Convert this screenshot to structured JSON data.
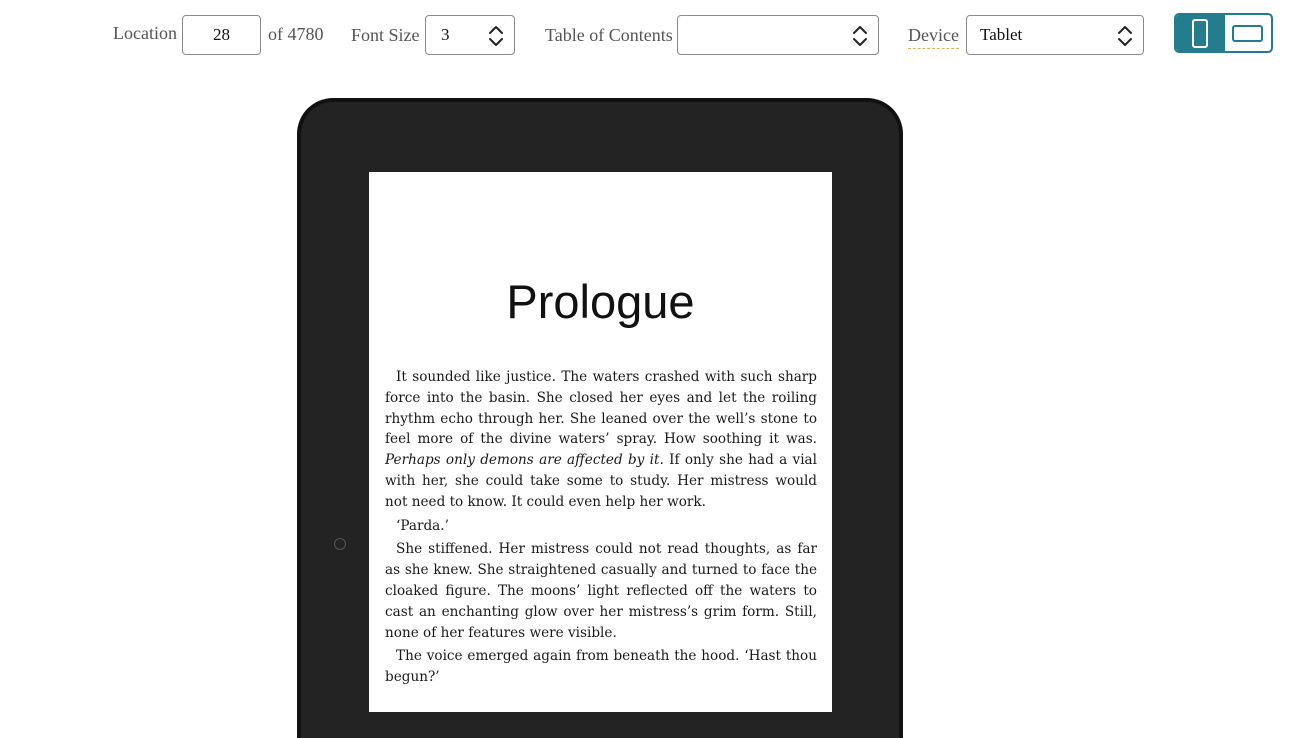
{
  "toolbar": {
    "location_label": "Location",
    "location_value": "28",
    "location_total": "of 4780",
    "font_size_label": "Font Size",
    "font_size_value": "3",
    "toc_label": "Table of Contents",
    "toc_value": "",
    "device_label": "Device",
    "device_value": "Tablet",
    "orientation": "portrait"
  },
  "book": {
    "chapter_title": "Prologue",
    "paragraphs": [
      {
        "before": "It sounded like justice. The waters crashed with such sharp force into the basin. She closed her eyes and let the roiling rhythm echo through her. She leaned over the well’s stone to feel more of the divine waters’ spray. How soothing it was. ",
        "italic": "Perhaps only demons are affected by it.",
        "after": " If only she had a vial with her, she could take some to study. Her mistress would not need to know. It could even help her work."
      },
      {
        "text": "‘Parda.’"
      },
      {
        "text": "She stiffened. Her mistress could not read thoughts, as far as she knew. She straightened casually and turned to face the cloaked figure. The moons’ light reflected off the waters to cast an enchanting glow over her mistress’s grim form. Still, none of her features were visible."
      },
      {
        "text": "The voice emerged again from beneath the hood. ‘Hast thou begun?’"
      }
    ]
  },
  "colors": {
    "accent": "#237d8d",
    "device_frame": "#232323"
  }
}
